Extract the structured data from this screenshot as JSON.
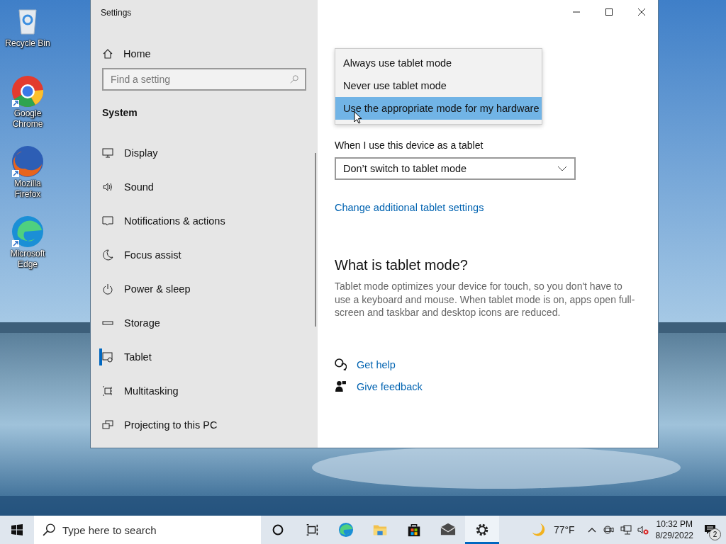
{
  "desktop_icons": [
    {
      "kind": "recycle",
      "label": "Recycle Bin"
    },
    {
      "kind": "chrome",
      "label": "Google Chrome"
    },
    {
      "kind": "firefox",
      "label": "Mozilla Firefox"
    },
    {
      "kind": "edge",
      "label": "Microsoft Edge"
    }
  ],
  "window": {
    "title": "Settings",
    "sidebar": {
      "home": "Home",
      "search_placeholder": "Find a setting",
      "section": "System",
      "items": [
        {
          "label": "Display",
          "selected": false
        },
        {
          "label": "Sound",
          "selected": false
        },
        {
          "label": "Notifications & actions",
          "selected": false
        },
        {
          "label": "Focus assist",
          "selected": false
        },
        {
          "label": "Power & sleep",
          "selected": false
        },
        {
          "label": "Storage",
          "selected": false
        },
        {
          "label": "Tablet",
          "selected": true
        },
        {
          "label": "Multitasking",
          "selected": false
        },
        {
          "label": "Projecting to this PC",
          "selected": false
        }
      ]
    },
    "content": {
      "dropdown_options": [
        {
          "label": "Always use tablet mode",
          "selected": false
        },
        {
          "label": "Never use tablet mode",
          "selected": false
        },
        {
          "label": "Use the appropriate mode for my hardware",
          "selected": true
        }
      ],
      "field_label": "When I use this device as a tablet",
      "select_value": "Don’t switch to tablet mode",
      "link": "Change additional tablet settings",
      "about_heading": "What is tablet mode?",
      "about_text": "Tablet mode optimizes your device for touch, so you don't have to use a keyboard and mouse. When tablet mode is on, apps open full-screen and taskbar and desktop icons are reduced.",
      "help_links": [
        {
          "kind": "help",
          "label": "Get help"
        },
        {
          "kind": "feedback",
          "label": "Give feedback"
        }
      ]
    }
  },
  "taskbar": {
    "search_placeholder": "Type here to search",
    "apps": [
      {
        "kind": "cortana",
        "active": false
      },
      {
        "kind": "taskview",
        "active": false
      },
      {
        "kind": "edge",
        "active": false
      },
      {
        "kind": "explorer",
        "active": false
      },
      {
        "kind": "store",
        "active": false
      },
      {
        "kind": "mail",
        "active": false
      },
      {
        "kind": "settings",
        "active": true
      }
    ],
    "weather": "77°F",
    "time": "10:32 PM",
    "date": "8/29/2022",
    "notifications": "2"
  }
}
